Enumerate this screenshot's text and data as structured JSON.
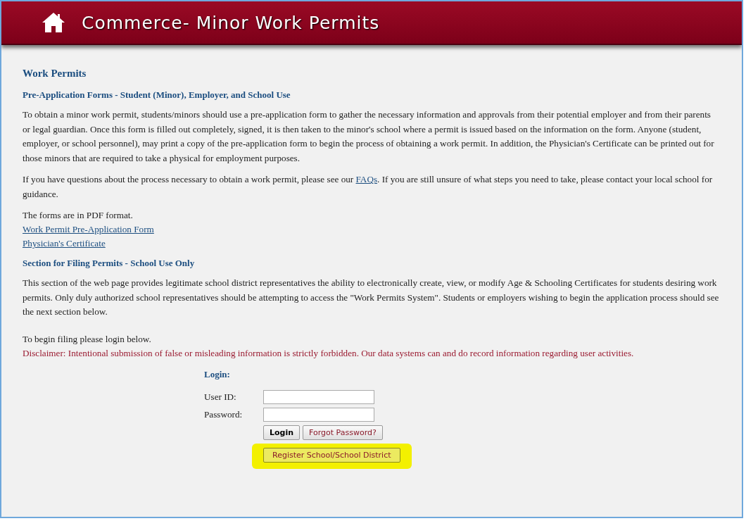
{
  "header": {
    "title": "Commerce- Minor Work Permits"
  },
  "page_title": "Work Permits",
  "sections": [
    {
      "heading": "Pre-Application Forms - Student (Minor), Employer, and School Use",
      "blocks": [
        {
          "kind": "paragraph",
          "text": "To obtain a minor work permit, students/minors should use a pre-application form to gather the necessary information and approvals from their potential employer and from their parents or legal guardian. Once this form is filled out completely, signed, it is then taken to the minor's school where a permit is issued based on the information on the form. Anyone (student, employer, or school personnel), may print a copy of the pre-application form to begin the process of obtaining a work permit. In addition, the Physician's Certificate can be printed out for those minors that are required to take a physical for employment purposes."
        },
        {
          "kind": "paragraph_link",
          "before": "If you have questions about the process necessary to obtain a work permit, please see our ",
          "link": "FAQs",
          "after": ". If you are still unsure of what steps you need to take, please contact your local school for guidance."
        },
        {
          "kind": "lines",
          "text": "The forms are in PDF format.",
          "links": [
            "Work Permit Pre-Application Form",
            "Physician's Certificate"
          ]
        }
      ]
    },
    {
      "heading": "Section for Filing Permits - School Use Only",
      "blocks": [
        {
          "kind": "paragraph",
          "text": "This section of the web page provides legitimate school district representatives the ability to electronically create, view, or modify Age & Schooling Certificates for students desiring work permits. Only duly authorized school representatives should be attempting to access the \"Work Permits System\". Students or employers wishing to begin the application process should see the next section below."
        }
      ]
    }
  ],
  "login_intro": "To begin filing please login below.",
  "disclaimer": "Disclaimer: Intentional submission of false or misleading information is strictly forbidden. Our data systems can and do record information regarding user activities.",
  "login": {
    "heading": "Login:",
    "fields": [
      {
        "label": "User ID:"
      },
      {
        "label": "Password:"
      }
    ],
    "login_button": "Login",
    "forgot_button": "Forgot Password?",
    "register_button": "Register School/School District",
    "register_highlighted": true
  }
}
